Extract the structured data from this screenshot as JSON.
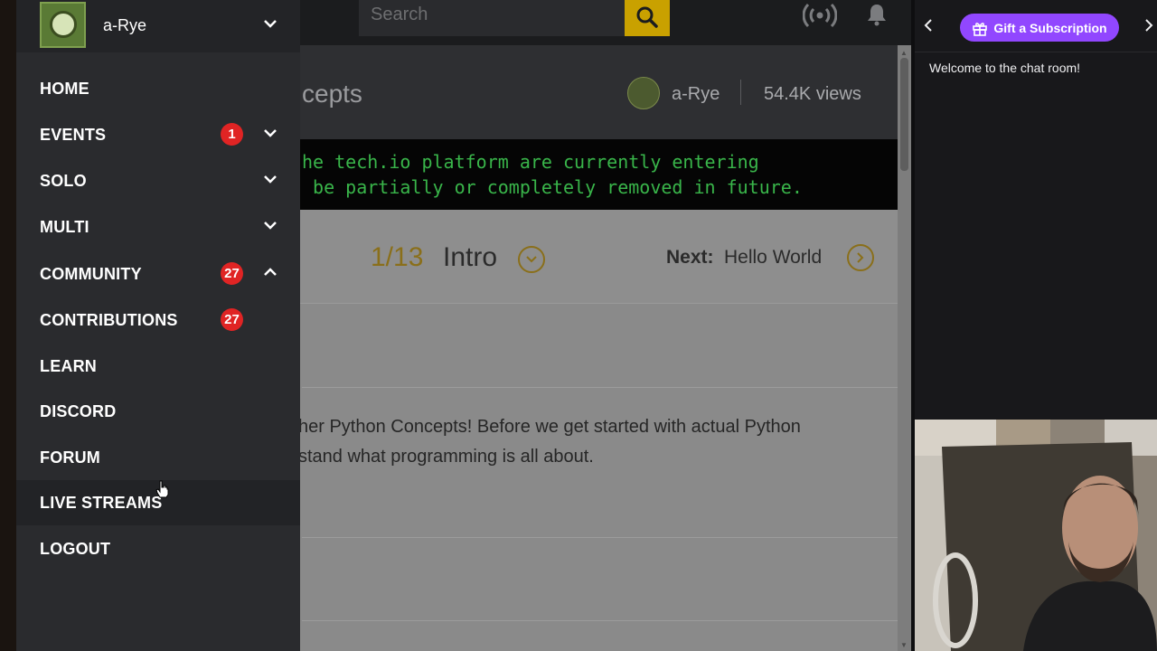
{
  "topbar": {
    "search_placeholder": "Search",
    "icons": {
      "search": "search-icon",
      "broadcast": "broadcast-icon",
      "bell": "bell-icon"
    }
  },
  "page": {
    "title_fragment": "cepts",
    "author": "a-Rye",
    "views": "54.4K views",
    "notice_lines": [
      "he tech.io platform are currently entering",
      " be partially or completely removed in future."
    ],
    "lesson_counter": "1/13",
    "lesson_title": "Intro",
    "next_label": "Next:",
    "next_title": "Hello World",
    "paragraph_lines": [
      "her Python Concepts! Before we get started with actual Python",
      "stand what programming is all about."
    ]
  },
  "sidebar": {
    "username": "a-Rye",
    "items": [
      {
        "label": "HOME"
      },
      {
        "label": "EVENTS",
        "badge": "1",
        "chevron": "down"
      },
      {
        "label": "SOLO",
        "chevron": "down"
      },
      {
        "label": "MULTI",
        "chevron": "down"
      },
      {
        "label": "COMMUNITY",
        "badge": "27",
        "chevron": "up"
      },
      {
        "label": "CONTRIBUTIONS",
        "badge": "27"
      },
      {
        "label": "LEARN"
      },
      {
        "label": "DISCORD"
      },
      {
        "label": "FORUM"
      },
      {
        "label": "LIVE STREAMS"
      },
      {
        "label": "LOGOUT"
      }
    ]
  },
  "chat": {
    "gift_button": "Gift a Subscription",
    "welcome": "Welcome to the chat room!"
  },
  "colors": {
    "accent_gold": "#c9a100",
    "badge_red": "#e02424",
    "twitch_purple": "#9147ff",
    "terminal_green": "#39b54a"
  }
}
